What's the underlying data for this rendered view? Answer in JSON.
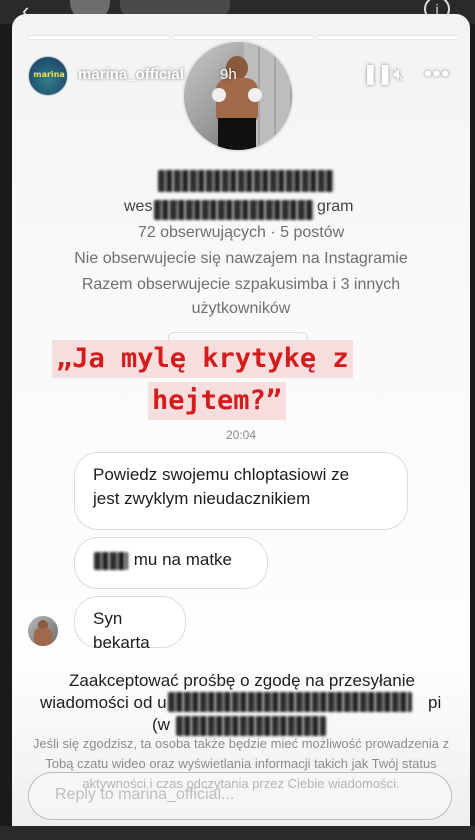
{
  "story": {
    "username": "marina_official",
    "time_ago": "9h",
    "brand_text": "marina",
    "progress_segments": 3,
    "controls": {
      "pause_icon": "pause-icon",
      "mute_icon": "speaker-muted-icon",
      "more_icon": "more-dots-icon"
    }
  },
  "profile": {
    "followers_line_left": "wes",
    "followers_line_right": "gram",
    "stats": "72 obserwujących · 5 postów",
    "mutual_follow": "Nie obserwujecie się nawzajem na Instagramie",
    "mutual_friends_line1": "Razem obserwujecie szpakusimba i 3 innych",
    "mutual_friends_line2": "użytkowników"
  },
  "highlight": {
    "line1": "„Ja mylę krytykę z",
    "line2": "hejtem?”"
  },
  "thread": {
    "timestamp": "20:04",
    "messages": [
      {
        "line1": "Powiedz swojemu chloptasiowi ze",
        "line2": "jest zwyklym nieudacznikiem"
      },
      {
        "text": "mu na matke"
      },
      {
        "text": "Syn bekarta"
      }
    ]
  },
  "request": {
    "line1": "Zaakceptować prośbę o zgodę na przesyłanie",
    "line2_left": "wiadomości od u",
    "line2_right": "pi",
    "line3_left": "(w",
    "fine_print": "Jeśli się zgodzisz, ta osoba także będzie mieć możliwość prowadzenia z Tobą czatu wideo oraz wyświetlania informacji takich jak Twój status aktywności i czas odczytania przez Ciebie wiadomości.",
    "reply_placeholder": "Reply to marina_official..."
  }
}
